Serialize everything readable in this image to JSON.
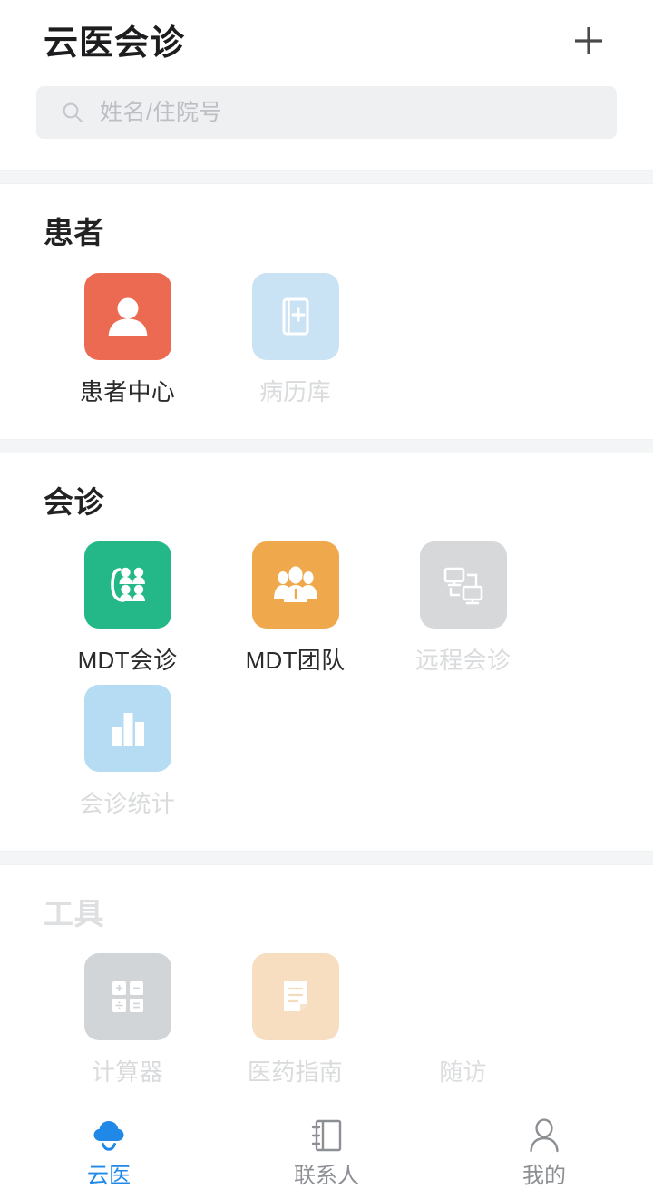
{
  "header": {
    "title": "云医会诊",
    "add_icon": "plus-icon"
  },
  "search": {
    "placeholder": "姓名/住院号",
    "value": "",
    "icon": "search-icon"
  },
  "sections": [
    {
      "key": "patients",
      "title": "患者",
      "disabled": false,
      "items": [
        {
          "label": "患者中心",
          "icon": "user-avatar-icon",
          "color": "#ec6a52",
          "disabled": false
        },
        {
          "label": "病历库",
          "icon": "medical-record-book-icon",
          "color": "#c9e2f4",
          "disabled": true
        }
      ]
    },
    {
      "key": "consultation",
      "title": "会诊",
      "disabled": false,
      "items": [
        {
          "label": "MDT会诊",
          "icon": "group-consult-icon",
          "color": "#24b888",
          "disabled": false
        },
        {
          "label": "MDT团队",
          "icon": "team-people-icon",
          "color": "#efa84c",
          "disabled": false
        },
        {
          "label": "远程会诊",
          "icon": "remote-screens-icon",
          "color": "#d6d8da",
          "disabled": true
        },
        {
          "label": "会诊统计",
          "icon": "bar-chart-icon",
          "color": "#b6dcf4",
          "disabled": true
        }
      ]
    },
    {
      "key": "tools",
      "title": "工具",
      "disabled": true,
      "items": [
        {
          "label": "计算器",
          "icon": "calculator-icon",
          "color": "#d2d5d7",
          "disabled": true
        },
        {
          "label": "医药指南",
          "icon": "document-lines-icon",
          "color": "#f7dec0",
          "disabled": true
        },
        {
          "label": "随访",
          "icon": "none",
          "color": "transparent",
          "disabled": true
        }
      ]
    }
  ],
  "tabbar": {
    "active_color": "#2089e8",
    "inactive_color": "#8c8f94",
    "tabs": [
      {
        "label": "云医",
        "icon": "cloud-icon",
        "active": true
      },
      {
        "label": "联系人",
        "icon": "contacts-book-icon",
        "active": false
      },
      {
        "label": "我的",
        "icon": "person-icon",
        "active": false
      }
    ]
  }
}
